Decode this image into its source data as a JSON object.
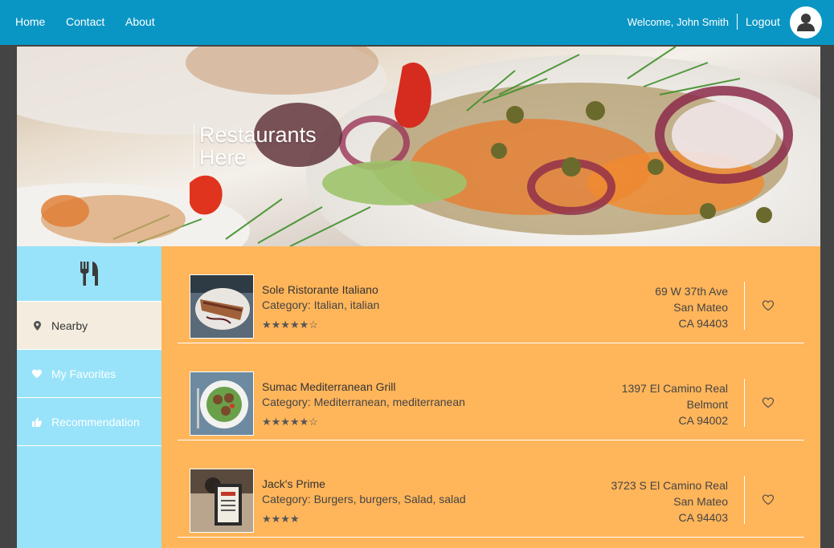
{
  "nav": {
    "home": "Home",
    "contact": "Contact",
    "about": "About"
  },
  "user": {
    "welcome": "Welcome, John Smith",
    "logout": "Logout",
    "avatar_icon": "user-icon"
  },
  "hero": {
    "title_line1": "Restaurants",
    "title_line2": "Here"
  },
  "sidebar": {
    "header_icon": "fork-knife-icon",
    "items": [
      {
        "label": "Nearby",
        "icon": "map-pin-icon",
        "active": true
      },
      {
        "label": "My Favorites",
        "icon": "heart-icon",
        "active": false
      },
      {
        "label": "Recommendation",
        "icon": "thumbs-up-icon",
        "active": false
      }
    ]
  },
  "restaurants": [
    {
      "name": "Sole Ristorante Italiano",
      "category": "Category: Italian, italian",
      "stars": "★★★★★☆",
      "rating": 4.5,
      "address": [
        "69 W 37th Ave",
        "San Mateo",
        "CA 94403"
      ]
    },
    {
      "name": "Sumac Mediterranean Grill",
      "category": "Category: Mediterranean, mediterranean",
      "stars": "★★★★★☆",
      "rating": 4.5,
      "address": [
        "1397 El Camino Real",
        "Belmont",
        "CA 94002"
      ]
    },
    {
      "name": "Jack's Prime",
      "category": "Category: Burgers, burgers, Salad, salad",
      "stars": "★★★★",
      "rating": 4,
      "address": [
        "3723 S El Camino Real",
        "San Mateo",
        "CA 94403"
      ]
    }
  ],
  "colors": {
    "topbar": "#0a96c4",
    "sidebar": "#99e3fa",
    "sidebar_active": "#f4eddf",
    "content": "#ffb55a"
  }
}
